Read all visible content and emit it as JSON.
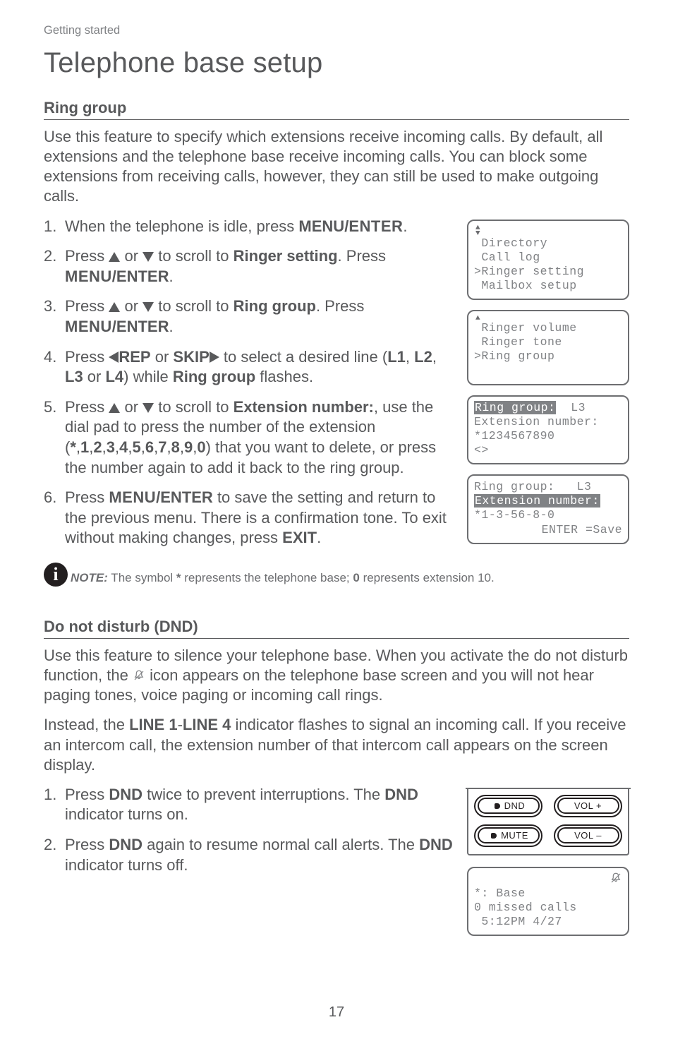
{
  "running_head": "Getting started",
  "title": "Telephone base setup",
  "page_number": "17",
  "ring_group": {
    "heading": "Ring group",
    "intro": "Use this feature to specify which extensions receive incoming calls. By default, all extensions and the telephone base receive incoming calls. You can block some extensions from receiving calls, however, they can still be used to make outgoing calls.",
    "steps": {
      "s1_a": "When the telephone is idle, press ",
      "s1_b": "MENU/",
      "s1_c": "ENTER",
      "s1_d": ".",
      "s2_a": "Press ",
      "s2_b": " or ",
      "s2_c": " to scroll to ",
      "s2_d": "Ringer setting",
      "s2_e": ". Press ",
      "s2_f": "MENU",
      "s2_g": "/ENTER",
      "s2_h": ".",
      "s3_a": "Press ",
      "s3_b": " or ",
      "s3_c": " to scroll to ",
      "s3_d": "Ring group",
      "s3_e": ". Press ",
      "s3_f": "MENU",
      "s3_g": "/",
      "s3_h": "ENTER",
      "s3_i": ".",
      "s4_a": "Press ",
      "s4_b": "REP",
      "s4_c": " or ",
      "s4_d": "SKIP",
      "s4_e": " to select a desired line (",
      "s4_f": "L1",
      "s4_g": ", ",
      "s4_h": "L2",
      "s4_i": ", ",
      "s4_j": "L3",
      "s4_k": " or ",
      "s4_l": "L4",
      "s4_m": ") while ",
      "s4_n": "Ring group",
      "s4_o": " flashes.",
      "s5_a": "Press ",
      "s5_b": " or ",
      "s5_c": " to scroll to ",
      "s5_d": "Extension number:",
      "s5_e": ", use the dial pad to press the number of the extension (",
      "s5_f": "*",
      "s5_g": ",",
      "s5_h": "1",
      "s5_i": ",",
      "s5_j": "2",
      "s5_k": ",",
      "s5_l": "3",
      "s5_m": ",",
      "s5_n": "4",
      "s5_o": ",",
      "s5_p": "5",
      "s5_q": ",",
      "s5_r": "6",
      "s5_s": ",",
      "s5_t": "7",
      "s5_u": ",",
      "s5_v": "8",
      "s5_w": ",",
      "s5_x": "9",
      "s5_y": ",",
      "s5_z": "0",
      "s5_aa": ") that you want to delete, or press the number again to add it back to the ring group.",
      "s6_a": "Press ",
      "s6_b": "MENU",
      "s6_c": "/ENTER",
      "s6_d": " to save the setting and return to the previous menu. There is a confirmation tone. To exit without making changes, press ",
      "s6_e": "EXIT",
      "s6_f": "."
    },
    "lcd1": {
      "l1": " Directory",
      "l2": " Call log",
      "l3": ">Ringer setting",
      "l4": " Mailbox setup"
    },
    "lcd2": {
      "l1": " Ringer volume",
      "l2": " Ringer tone",
      "l3": ">Ring group"
    },
    "lcd3": {
      "l1a": "Ring group:",
      "l1b": "  L3",
      "l2": "Extension number:",
      "l3": "*1234567890",
      "l4": "<>"
    },
    "lcd4": {
      "l1a": "Ring group:",
      "l1b": "   L3",
      "l2": "Extension number:",
      "l3": "*1-3-56-8-0",
      "l4": "ENTER =Save"
    }
  },
  "note": {
    "lead": "NOTE:",
    "body_a": " The symbol ",
    "body_b": "*",
    "body_c": " represents the telephone base; ",
    "body_d": "0",
    "body_e": " represents extension 10."
  },
  "dnd": {
    "heading": "Do not disturb (DND)",
    "p1_a": "Use this feature to silence your telephone base. When you activate the do not disturb function, the ",
    "p1_b": " icon appears on the telephone base screen and you will not hear paging tones, voice paging or incoming call rings.",
    "p2_a": "Instead, the ",
    "p2_b": "LINE 1",
    "p2_c": "-",
    "p2_d": "LINE 4",
    "p2_e": " indicator flashes to signal an incoming call. If you receive an intercom call, the extension number of that intercom call appears on the screen display.",
    "steps": {
      "s1_a": "Press ",
      "s1_b": "DND",
      "s1_c": " twice to prevent interruptions. The ",
      "s1_d": "DND",
      "s1_e": " indicator turns on.",
      "s2_a": "Press ",
      "s2_b": "DND",
      "s2_c": " again to resume normal call alerts. The ",
      "s2_d": "DND",
      "s2_e": " indicator turns off."
    },
    "buttons": {
      "dnd": "DND",
      "mute": "MUTE",
      "vol_up": "VOL +",
      "vol_dn": "VOL –"
    },
    "lcd": {
      "l1": "*: Base",
      "l2": "0 missed calls",
      "l3": " 5:12PM 4/27"
    }
  }
}
